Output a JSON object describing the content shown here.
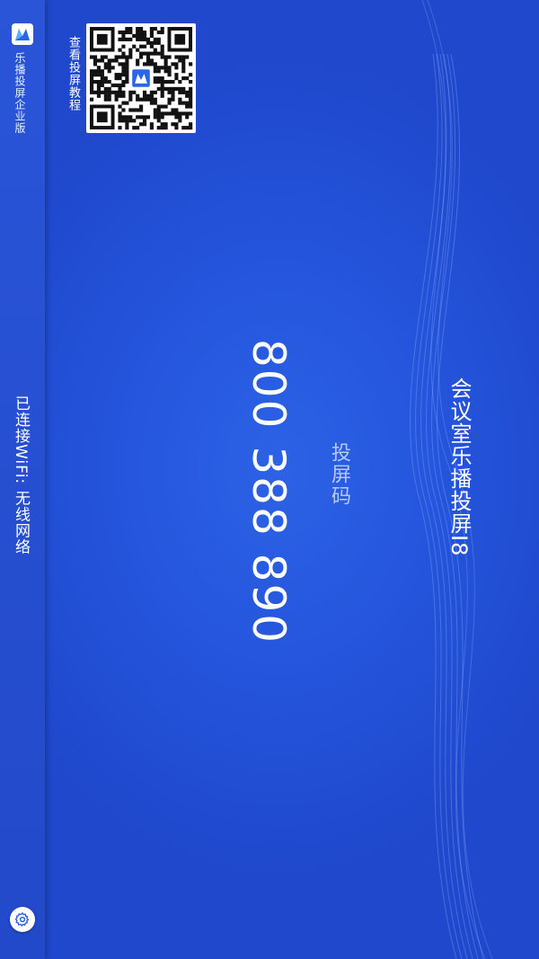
{
  "sidebar": {
    "brand_name": "乐播投屏企业版",
    "brand_icon": "lebo-logo-icon",
    "wifi_status": "已连接WiFi: 无线网络",
    "settings_icon": "gear-icon"
  },
  "qr": {
    "label": "查看投屏教程",
    "icon": "qr-code-icon"
  },
  "main": {
    "code_label": "投屏码",
    "code_value": "800 388 890",
    "device_name": "会议室乐播投屏I8"
  },
  "colors": {
    "background": "#2556dd",
    "sidebar": "#2249c9",
    "text": "#ffffff",
    "label_muted": "#b9c9f3"
  }
}
